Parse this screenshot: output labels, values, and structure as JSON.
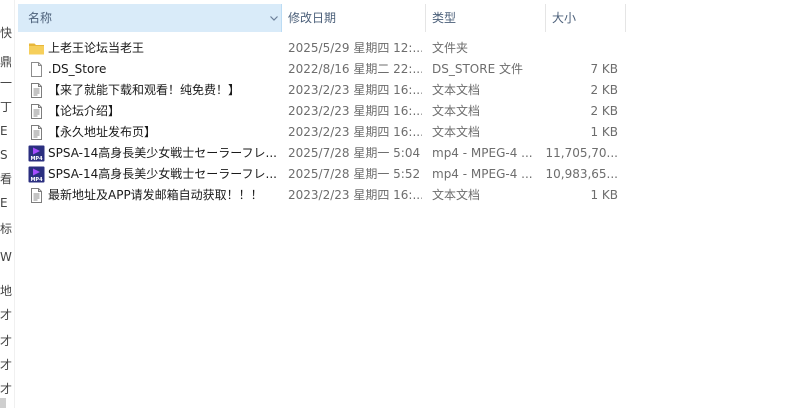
{
  "nav_pane_glyphs": [
    "快",
    "鼎",
    "一",
    "丁",
    "E",
    "S",
    "看",
    "E",
    "标",
    "W",
    "地",
    "才",
    "才",
    "才",
    "才"
  ],
  "header": {
    "name_label": "名称",
    "date_label": "修改日期",
    "type_label": "类型",
    "size_label": "大小",
    "sort_indicator": "^"
  },
  "files": [
    {
      "name": "上老王论坛当老王",
      "date": "2025/5/29 星期四 12:...",
      "type": "文件夹",
      "size": "",
      "icon": "folder-icon"
    },
    {
      "name": ".DS_Store",
      "date": "2022/8/16 星期二 22:...",
      "type": "DS_STORE 文件",
      "size": "7 KB",
      "icon": "file-icon"
    },
    {
      "name": "【来了就能下载和观看！纯免费！】",
      "date": "2023/2/23 星期四 16:...",
      "type": "文本文档",
      "size": "2 KB",
      "icon": "text-document-icon"
    },
    {
      "name": "【论坛介绍】",
      "date": "2023/2/23 星期四 16:...",
      "type": "文本文档",
      "size": "2 KB",
      "icon": "text-document-icon"
    },
    {
      "name": "【永久地址发布页】",
      "date": "2023/2/23 星期四 16:...",
      "type": "文本文档",
      "size": "1 KB",
      "icon": "text-document-icon"
    },
    {
      "name": "SPSA-14高身長美少女戦士セーラーフレ...",
      "date": "2025/7/28 星期一 5:04",
      "type": "mp4 - MPEG-4 ...",
      "size": "11,705,70...",
      "icon": "mp4-video-icon"
    },
    {
      "name": "SPSA-14高身長美少女戦士セーラーフレ...",
      "date": "2025/7/28 星期一 5:52",
      "type": "mp4 - MPEG-4 ...",
      "size": "10,983,65...",
      "icon": "mp4-video-icon"
    },
    {
      "name": "最新地址及APP请发邮箱自动获取！！！",
      "date": "2023/2/23 星期四 16:...",
      "type": "文本文档",
      "size": "1 KB",
      "icon": "text-document-icon"
    }
  ],
  "mp4_icon_label": "MP4",
  "colors": {
    "header_selected_bg": "#d9ebf9",
    "header_text": "#4c607a",
    "folder": "#f2c94c",
    "mp4_icon_bg": "#2b2f80",
    "mp4_icon_accent": "#a64dff"
  }
}
